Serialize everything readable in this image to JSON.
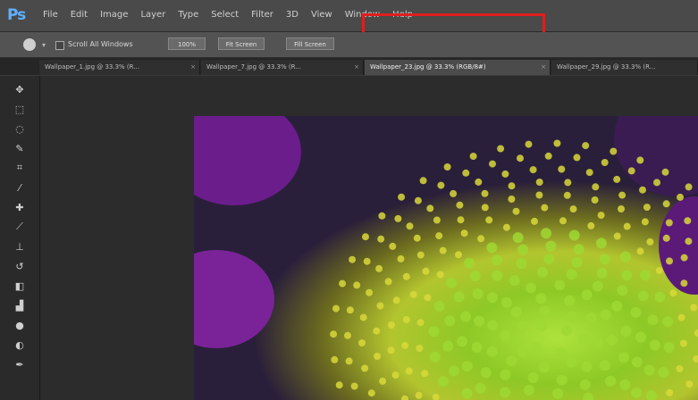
{
  "app": {
    "logo": "Ps"
  },
  "menu": [
    "File",
    "Edit",
    "Image",
    "Layer",
    "Type",
    "Select",
    "Filter",
    "3D",
    "View",
    "Window",
    "Help"
  ],
  "options": {
    "scroll_label": "Scroll All Windows",
    "buttons": [
      "100%",
      "Fit Screen",
      "Fill Screen"
    ]
  },
  "tabs": [
    {
      "label": "Wallpaper_1.jpg @ 33.3% (R...",
      "active": false
    },
    {
      "label": "Wallpaper_7.jpg @ 33.3% (R...",
      "active": false
    },
    {
      "label": "Wallpaper_23.jpg @ 33.3% (RGB/8#)",
      "active": true
    },
    {
      "label": "Wallpaper_29.jpg @ 33.3% (R...",
      "active": false
    }
  ],
  "tools": [
    "move-tool",
    "marquee-tool",
    "lasso-tool",
    "quick-select-tool",
    "crop-tool",
    "eyedropper-tool",
    "healing-brush-tool",
    "brush-tool",
    "clone-stamp-tool",
    "history-brush-tool",
    "eraser-tool",
    "gradient-tool",
    "blur-tool",
    "dodge-tool",
    "pen-tool"
  ],
  "colors": {
    "highlight": "#e01e1e",
    "accent": "#5fb0ff"
  }
}
